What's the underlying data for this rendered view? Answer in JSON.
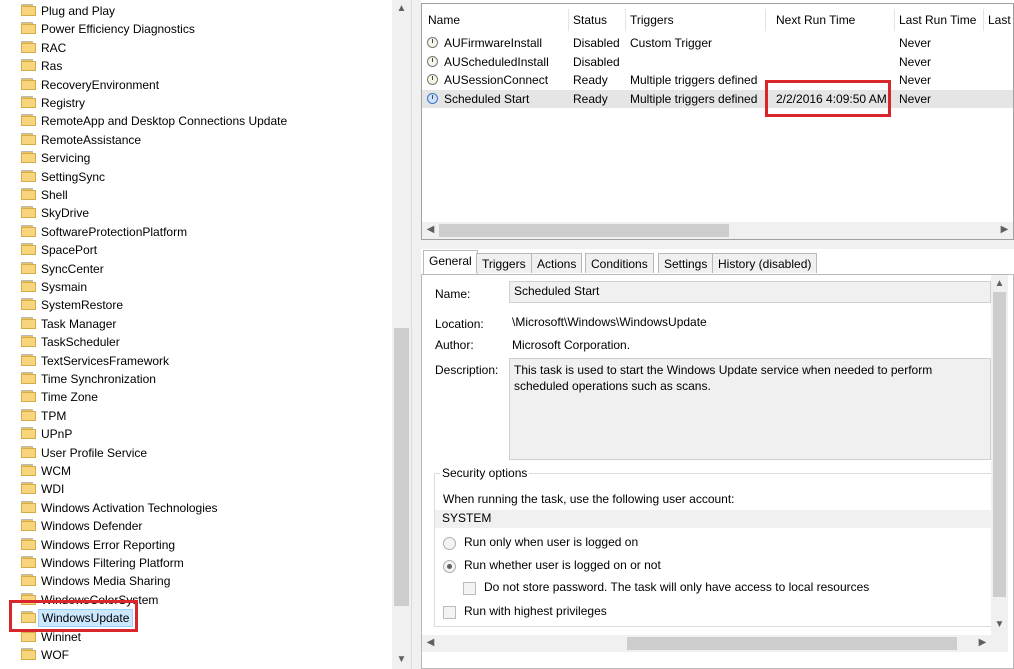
{
  "tree": {
    "items": [
      {
        "label": "Plug and Play"
      },
      {
        "label": "Power Efficiency Diagnostics"
      },
      {
        "label": "RAC"
      },
      {
        "label": "Ras"
      },
      {
        "label": "RecoveryEnvironment"
      },
      {
        "label": "Registry"
      },
      {
        "label": "RemoteApp and Desktop Connections Update"
      },
      {
        "label": "RemoteAssistance"
      },
      {
        "label": "Servicing"
      },
      {
        "label": "SettingSync"
      },
      {
        "label": "Shell"
      },
      {
        "label": "SkyDrive"
      },
      {
        "label": "SoftwareProtectionPlatform"
      },
      {
        "label": "SpacePort"
      },
      {
        "label": "SyncCenter"
      },
      {
        "label": "Sysmain"
      },
      {
        "label": "SystemRestore"
      },
      {
        "label": "Task Manager"
      },
      {
        "label": "TaskScheduler"
      },
      {
        "label": "TextServicesFramework"
      },
      {
        "label": "Time Synchronization"
      },
      {
        "label": "Time Zone"
      },
      {
        "label": "TPM"
      },
      {
        "label": "UPnP"
      },
      {
        "label": "User Profile Service"
      },
      {
        "label": "WCM"
      },
      {
        "label": "WDI"
      },
      {
        "label": "Windows Activation Technologies"
      },
      {
        "label": "Windows Defender"
      },
      {
        "label": "Windows Error Reporting"
      },
      {
        "label": "Windows Filtering Platform"
      },
      {
        "label": "Windows Media Sharing"
      },
      {
        "label": "WindowsColorSystem"
      },
      {
        "label": "WindowsUpdate",
        "selected": true
      },
      {
        "label": "Wininet"
      },
      {
        "label": "WOF"
      }
    ]
  },
  "tasklist": {
    "columns": [
      "Name",
      "Status",
      "Triggers",
      "Next Run Time",
      "Last Run Time",
      "Last"
    ],
    "rows": [
      {
        "name": "AUFirmwareInstall",
        "status": "Disabled",
        "triggers": "Custom Trigger",
        "next": "",
        "last": "Never"
      },
      {
        "name": "AUScheduledInstall",
        "status": "Disabled",
        "triggers": "",
        "next": "",
        "last": "Never"
      },
      {
        "name": "AUSessionConnect",
        "status": "Ready",
        "triggers": "Multiple triggers defined",
        "next": "",
        "last": "Never"
      },
      {
        "name": "Scheduled Start",
        "status": "Ready",
        "triggers": "Multiple triggers defined",
        "next": "2/2/2016 4:09:50 AM",
        "last": "Never",
        "selected": true
      }
    ]
  },
  "tabs": [
    "General",
    "Triggers",
    "Actions",
    "Conditions",
    "Settings",
    "History (disabled)"
  ],
  "general": {
    "name_label": "Name:",
    "name_value": "Scheduled Start",
    "location_label": "Location:",
    "location_value": "\\Microsoft\\Windows\\WindowsUpdate",
    "author_label": "Author:",
    "author_value": "Microsoft Corporation.",
    "description_label": "Description:",
    "description_value": "This task is used to start the Windows Update service when needed to perform scheduled operations such as scans.",
    "security_legend": "Security options",
    "account_prompt": "When running the task, use the following user account:",
    "account_value": "SYSTEM",
    "radio_logged_on": "Run only when user is logged on",
    "radio_logged_on_or_not": "Run whether user is logged on or not",
    "checkbox_no_store_password": "Do not store password.  The task will only have access to local resources",
    "checkbox_highest": "Run with highest privileges"
  },
  "colors": {
    "highlight_box": "#d9262b",
    "selection": "#cce8ff"
  }
}
